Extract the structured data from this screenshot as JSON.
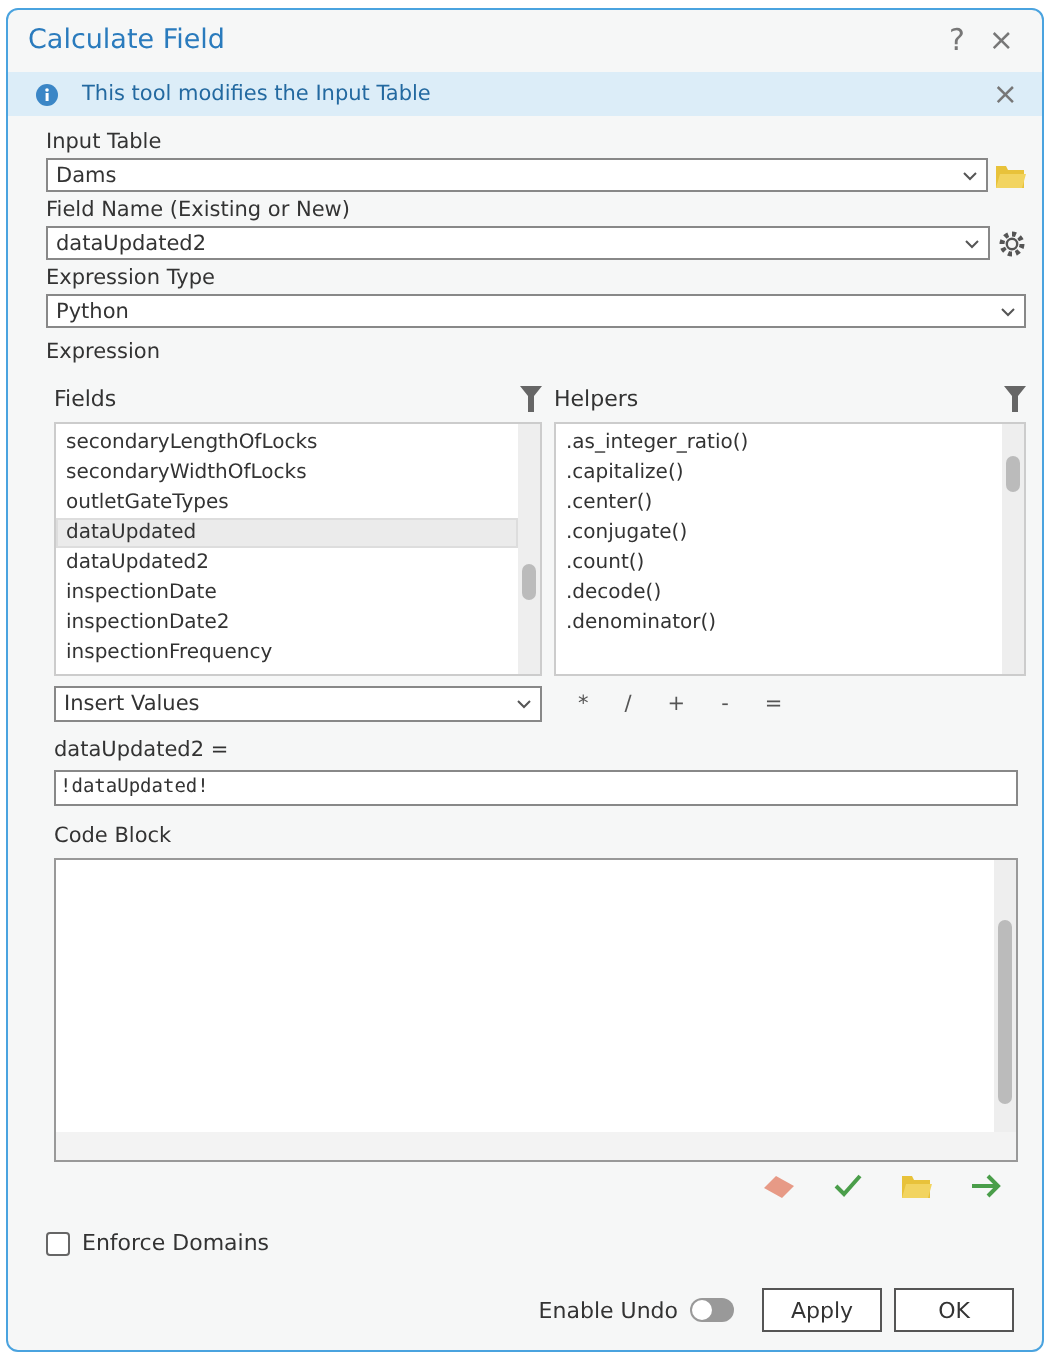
{
  "window": {
    "title": "Calculate Field",
    "help": "?",
    "close": "×"
  },
  "info_bar": {
    "message": "This tool modifies the Input Table",
    "close": "×"
  },
  "input_table": {
    "label": "Input Table",
    "value": "Dams"
  },
  "field_name": {
    "label": "Field Name (Existing or New)",
    "value": "dataUpdated2"
  },
  "expression_type": {
    "label": "Expression Type",
    "value": "Python"
  },
  "expression": {
    "label": "Expression",
    "fields": {
      "label": "Fields",
      "items": [
        {
          "name": "secondaryLengthOfLocks",
          "selected": false
        },
        {
          "name": "secondaryWidthOfLocks",
          "selected": false
        },
        {
          "name": "outletGateTypes",
          "selected": false
        },
        {
          "name": "dataUpdated",
          "selected": true
        },
        {
          "name": "dataUpdated2",
          "selected": false
        },
        {
          "name": "inspectionDate",
          "selected": false
        },
        {
          "name": "inspectionDate2",
          "selected": false
        },
        {
          "name": "inspectionFrequency",
          "selected": false
        }
      ]
    },
    "helpers": {
      "label": "Helpers",
      "items": [
        ".as_integer_ratio()",
        ".capitalize()",
        ".center()",
        ".conjugate()",
        ".count()",
        ".decode()",
        ".denominator()"
      ]
    },
    "insert_values": "Insert Values",
    "operators": [
      "*",
      "/",
      "+",
      "-",
      "="
    ],
    "target_label": "dataUpdated2 =",
    "value": "!dataUpdated!"
  },
  "code_block": {
    "label": "Code Block"
  },
  "enforce_domains": {
    "label": "Enforce Domains",
    "checked": false
  },
  "enable_undo": {
    "label": "Enable Undo",
    "on": false
  },
  "buttons": [
    "Apply",
    "OK"
  ]
}
